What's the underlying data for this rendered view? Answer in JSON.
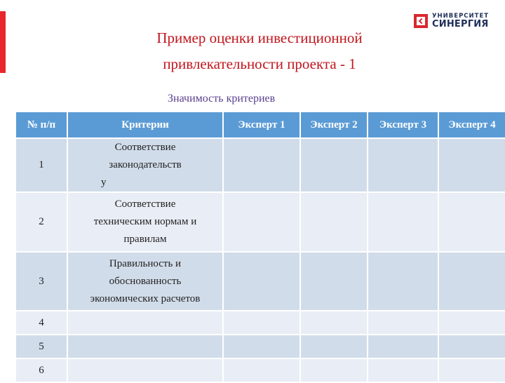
{
  "logo": {
    "top_line": "УНИВЕРСИТЕТ",
    "bottom_line": "СИНЕРГИЯ"
  },
  "title": {
    "line1": "Пример оценки инвестиционной",
    "line2": "привлекательности проекта - 1"
  },
  "subtitle": "Значимость критериев",
  "table": {
    "headers": [
      "№ п/п",
      "Критерии",
      "Эксперт 1",
      "Эксперт 2",
      "Эксперт 3",
      "Эксперт 4"
    ],
    "rows": [
      {
        "num": "1",
        "criterion_lines": [
          "Соответствие",
          "законодательств",
          "у"
        ],
        "experts": [
          "",
          "",
          "",
          ""
        ]
      },
      {
        "num": "2",
        "criterion_lines": [
          "Соответствие",
          "техническим нормам и",
          "правилам"
        ],
        "experts": [
          "",
          "",
          "",
          ""
        ]
      },
      {
        "num": "3",
        "criterion_lines": [
          "Правильность и",
          "обоснованность",
          "экономических расчетов"
        ],
        "experts": [
          "",
          "",
          "",
          ""
        ]
      },
      {
        "num": "4",
        "criterion_lines": [],
        "experts": [
          "",
          "",
          "",
          ""
        ]
      },
      {
        "num": "5",
        "criterion_lines": [],
        "experts": [
          "",
          "",
          "",
          ""
        ]
      },
      {
        "num": "6",
        "criterion_lines": [],
        "experts": [
          "",
          "",
          "",
          ""
        ]
      }
    ]
  },
  "colors": {
    "accent_red": "#e8262b",
    "title_red": "#c0151c",
    "subtitle_purple": "#5a3f8f",
    "header_blue": "#5b9bd5",
    "row_dark": "#d1dcea",
    "row_light": "#e9edf5"
  }
}
